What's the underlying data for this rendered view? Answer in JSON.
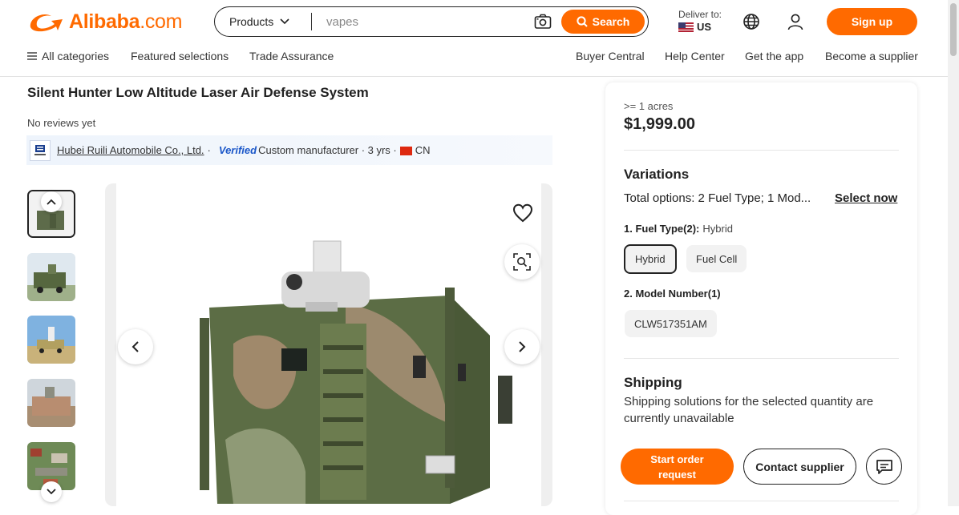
{
  "header": {
    "logo_text": "Alibaba",
    "logo_suffix": ".com",
    "search": {
      "category": "Products",
      "query": "vapes",
      "button_label": "Search"
    },
    "deliver": {
      "label": "Deliver to:",
      "country": "US"
    },
    "signup_label": "Sign up",
    "nav_left": [
      "All categories",
      "Featured selections",
      "Trade Assurance"
    ],
    "nav_right": [
      "Buyer Central",
      "Help Center",
      "Get the app",
      "Become a supplier"
    ]
  },
  "product": {
    "title": "Silent Hunter Low Altitude Laser Air Defense System",
    "reviews": "No reviews yet",
    "supplier": {
      "name": "Hubei Ruili Automobile Co., Ltd.",
      "verified": "Verified",
      "details_1": "Custom manufacturer · 3 yrs ·",
      "country": "CN"
    }
  },
  "purchase": {
    "moq": ">= 1 acres",
    "price": "$1,999.00",
    "variations_title": "Variations",
    "total_options": "Total options: 2 Fuel Type; 1 Mod...",
    "select_now": "Select now",
    "option1": {
      "title": "1. Fuel Type(2):",
      "selected": "Hybrid",
      "chips": [
        "Hybrid",
        "Fuel Cell"
      ]
    },
    "option2": {
      "title": "2. Model Number(1)",
      "chips": [
        "CLW517351AM"
      ]
    },
    "shipping_title": "Shipping",
    "shipping_text": "Shipping solutions for the selected quantity are currently unavailable",
    "start_order_line1": "Start order",
    "start_order_line2": "request",
    "contact_supplier": "Contact supplier"
  },
  "colors": {
    "accent": "#ff6a00",
    "verified": "#1a56c8"
  },
  "icons": [
    "chevron-down-icon",
    "camera-search-icon",
    "search-icon",
    "globe-icon",
    "user-icon",
    "menu-icon",
    "heart-icon",
    "zoom-icon",
    "chevron-left-icon",
    "chevron-right-icon",
    "chevron-up-icon",
    "chat-icon"
  ]
}
